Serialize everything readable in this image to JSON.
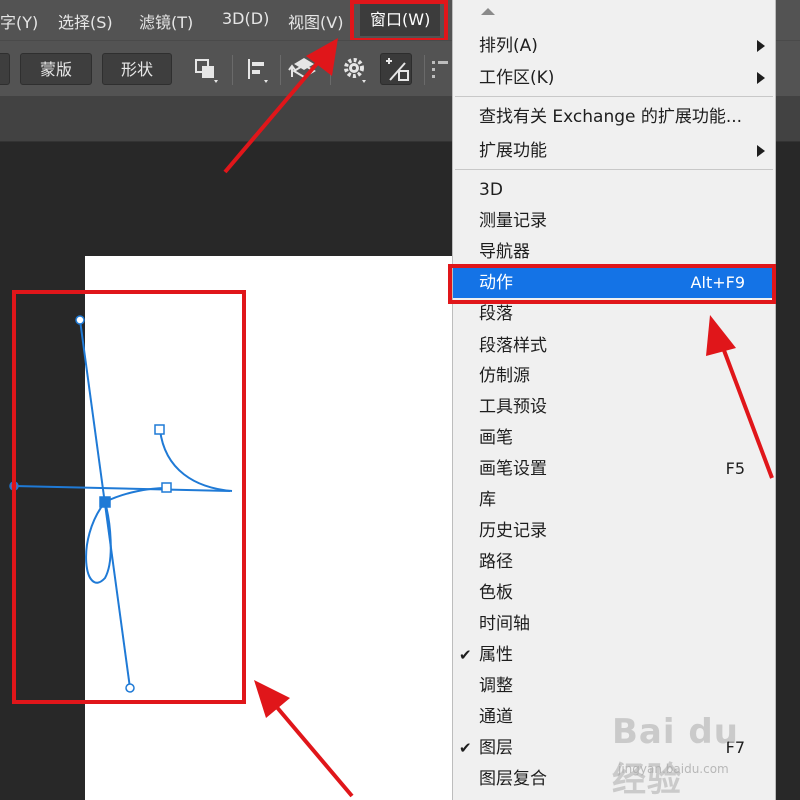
{
  "menubar": {
    "items": [
      "字(Y)",
      "选择(S)",
      "滤镜(T)",
      "3D(D)",
      "视图(V)"
    ],
    "active": "窗口(W)"
  },
  "options_bar": {
    "mask_button": "蒙版",
    "shape_button": "形状"
  },
  "window_menu": {
    "items": [
      {
        "label": "排列(A)",
        "submenu": true
      },
      {
        "label": "工作区(K)",
        "submenu": true
      },
      {
        "label": "查找有关 Exchange 的扩展功能..."
      },
      {
        "label": "扩展功能",
        "submenu": true
      },
      {
        "label": "3D"
      },
      {
        "label": "测量记录"
      },
      {
        "label": "导航器"
      },
      {
        "label": "动作",
        "shortcut": "Alt+F9",
        "highlighted": true
      },
      {
        "label": "段落"
      },
      {
        "label": "段落样式"
      },
      {
        "label": "仿制源"
      },
      {
        "label": "工具预设"
      },
      {
        "label": "画笔"
      },
      {
        "label": "画笔设置",
        "shortcut": "F5"
      },
      {
        "label": "库"
      },
      {
        "label": "历史记录"
      },
      {
        "label": "路径"
      },
      {
        "label": "色板"
      },
      {
        "label": "时间轴"
      },
      {
        "label": "属性",
        "checked": true
      },
      {
        "label": "调整"
      },
      {
        "label": "通道"
      },
      {
        "label": "图层",
        "checked": true,
        "shortcut": "F7"
      },
      {
        "label": "图层复合"
      }
    ],
    "check_mark": "✔"
  },
  "watermark": {
    "logo": "Bai du 经验",
    "url": "jingyan.baidu.com"
  },
  "colors": {
    "annotation_red": "#e0161a",
    "highlight_blue": "#1473e6",
    "path_blue": "#1f7ad6"
  },
  "icons": [
    "arrange-icon",
    "align-icon",
    "path-arrange-icon",
    "gear-icon",
    "constrain-path-icon",
    "submenu-arrow-icon",
    "check-icon"
  ]
}
